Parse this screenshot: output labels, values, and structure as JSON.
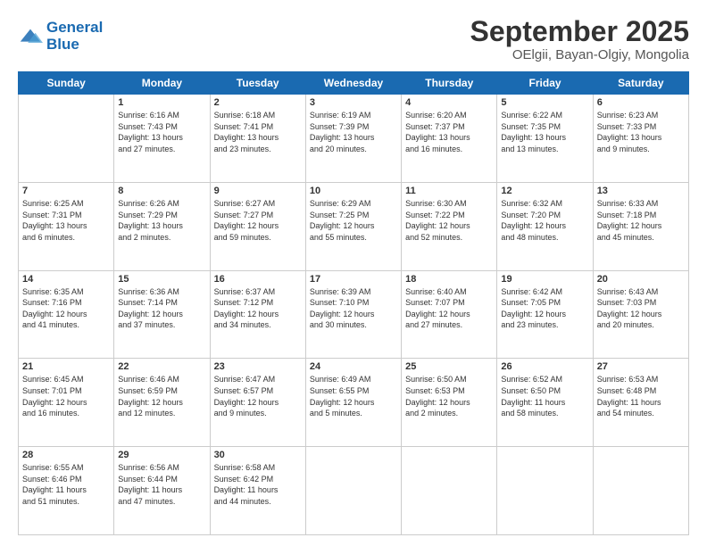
{
  "logo": {
    "line1": "General",
    "line2": "Blue"
  },
  "title": "September 2025",
  "subtitle": "OElgii, Bayan-Olgiy, Mongolia",
  "weekdays": [
    "Sunday",
    "Monday",
    "Tuesday",
    "Wednesday",
    "Thursday",
    "Friday",
    "Saturday"
  ],
  "weeks": [
    [
      {
        "day": "",
        "info": ""
      },
      {
        "day": "1",
        "info": "Sunrise: 6:16 AM\nSunset: 7:43 PM\nDaylight: 13 hours\nand 27 minutes."
      },
      {
        "day": "2",
        "info": "Sunrise: 6:18 AM\nSunset: 7:41 PM\nDaylight: 13 hours\nand 23 minutes."
      },
      {
        "day": "3",
        "info": "Sunrise: 6:19 AM\nSunset: 7:39 PM\nDaylight: 13 hours\nand 20 minutes."
      },
      {
        "day": "4",
        "info": "Sunrise: 6:20 AM\nSunset: 7:37 PM\nDaylight: 13 hours\nand 16 minutes."
      },
      {
        "day": "5",
        "info": "Sunrise: 6:22 AM\nSunset: 7:35 PM\nDaylight: 13 hours\nand 13 minutes."
      },
      {
        "day": "6",
        "info": "Sunrise: 6:23 AM\nSunset: 7:33 PM\nDaylight: 13 hours\nand 9 minutes."
      }
    ],
    [
      {
        "day": "7",
        "info": "Sunrise: 6:25 AM\nSunset: 7:31 PM\nDaylight: 13 hours\nand 6 minutes."
      },
      {
        "day": "8",
        "info": "Sunrise: 6:26 AM\nSunset: 7:29 PM\nDaylight: 13 hours\nand 2 minutes."
      },
      {
        "day": "9",
        "info": "Sunrise: 6:27 AM\nSunset: 7:27 PM\nDaylight: 12 hours\nand 59 minutes."
      },
      {
        "day": "10",
        "info": "Sunrise: 6:29 AM\nSunset: 7:25 PM\nDaylight: 12 hours\nand 55 minutes."
      },
      {
        "day": "11",
        "info": "Sunrise: 6:30 AM\nSunset: 7:22 PM\nDaylight: 12 hours\nand 52 minutes."
      },
      {
        "day": "12",
        "info": "Sunrise: 6:32 AM\nSunset: 7:20 PM\nDaylight: 12 hours\nand 48 minutes."
      },
      {
        "day": "13",
        "info": "Sunrise: 6:33 AM\nSunset: 7:18 PM\nDaylight: 12 hours\nand 45 minutes."
      }
    ],
    [
      {
        "day": "14",
        "info": "Sunrise: 6:35 AM\nSunset: 7:16 PM\nDaylight: 12 hours\nand 41 minutes."
      },
      {
        "day": "15",
        "info": "Sunrise: 6:36 AM\nSunset: 7:14 PM\nDaylight: 12 hours\nand 37 minutes."
      },
      {
        "day": "16",
        "info": "Sunrise: 6:37 AM\nSunset: 7:12 PM\nDaylight: 12 hours\nand 34 minutes."
      },
      {
        "day": "17",
        "info": "Sunrise: 6:39 AM\nSunset: 7:10 PM\nDaylight: 12 hours\nand 30 minutes."
      },
      {
        "day": "18",
        "info": "Sunrise: 6:40 AM\nSunset: 7:07 PM\nDaylight: 12 hours\nand 27 minutes."
      },
      {
        "day": "19",
        "info": "Sunrise: 6:42 AM\nSunset: 7:05 PM\nDaylight: 12 hours\nand 23 minutes."
      },
      {
        "day": "20",
        "info": "Sunrise: 6:43 AM\nSunset: 7:03 PM\nDaylight: 12 hours\nand 20 minutes."
      }
    ],
    [
      {
        "day": "21",
        "info": "Sunrise: 6:45 AM\nSunset: 7:01 PM\nDaylight: 12 hours\nand 16 minutes."
      },
      {
        "day": "22",
        "info": "Sunrise: 6:46 AM\nSunset: 6:59 PM\nDaylight: 12 hours\nand 12 minutes."
      },
      {
        "day": "23",
        "info": "Sunrise: 6:47 AM\nSunset: 6:57 PM\nDaylight: 12 hours\nand 9 minutes."
      },
      {
        "day": "24",
        "info": "Sunrise: 6:49 AM\nSunset: 6:55 PM\nDaylight: 12 hours\nand 5 minutes."
      },
      {
        "day": "25",
        "info": "Sunrise: 6:50 AM\nSunset: 6:53 PM\nDaylight: 12 hours\nand 2 minutes."
      },
      {
        "day": "26",
        "info": "Sunrise: 6:52 AM\nSunset: 6:50 PM\nDaylight: 11 hours\nand 58 minutes."
      },
      {
        "day": "27",
        "info": "Sunrise: 6:53 AM\nSunset: 6:48 PM\nDaylight: 11 hours\nand 54 minutes."
      }
    ],
    [
      {
        "day": "28",
        "info": "Sunrise: 6:55 AM\nSunset: 6:46 PM\nDaylight: 11 hours\nand 51 minutes."
      },
      {
        "day": "29",
        "info": "Sunrise: 6:56 AM\nSunset: 6:44 PM\nDaylight: 11 hours\nand 47 minutes."
      },
      {
        "day": "30",
        "info": "Sunrise: 6:58 AM\nSunset: 6:42 PM\nDaylight: 11 hours\nand 44 minutes."
      },
      {
        "day": "",
        "info": ""
      },
      {
        "day": "",
        "info": ""
      },
      {
        "day": "",
        "info": ""
      },
      {
        "day": "",
        "info": ""
      }
    ]
  ]
}
